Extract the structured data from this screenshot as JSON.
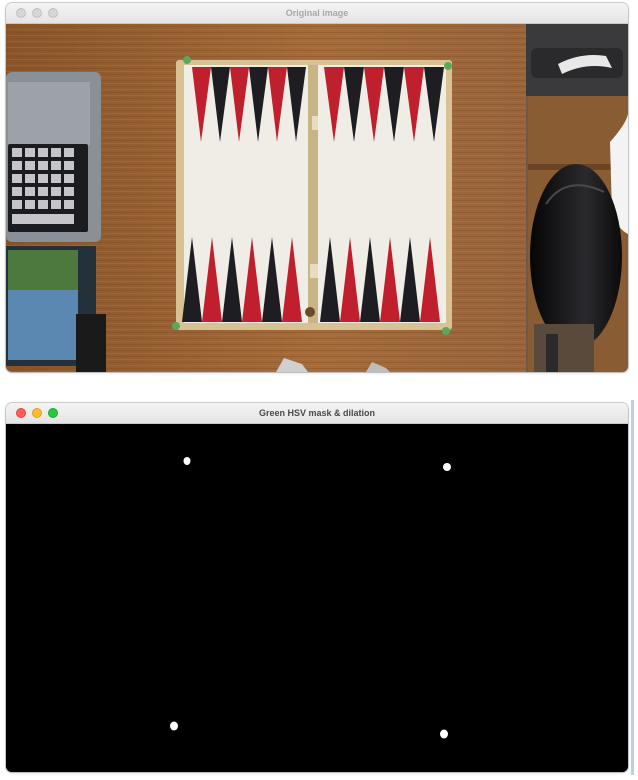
{
  "windows": [
    {
      "id": "original",
      "title": "Original image",
      "active": false,
      "traffic_lights": [
        "close",
        "minimize",
        "zoom"
      ]
    },
    {
      "id": "mask",
      "title": "Green HSV mask & dilation",
      "active": true,
      "traffic_lights": [
        "close",
        "minimize",
        "zoom"
      ]
    }
  ],
  "photo": {
    "table_color": "#9a6434",
    "board_frame_color": "#d8c294",
    "board_field_color": "#eeece5",
    "point_colors": [
      "#c0202e",
      "#1d1d22"
    ],
    "corner_marker_color": "#5aa85a",
    "laptop_color": "#8b8f96",
    "chair_color": "#111111"
  },
  "mask": {
    "background": "#000000",
    "blob_color": "#ffffff",
    "blob_count": 4
  }
}
